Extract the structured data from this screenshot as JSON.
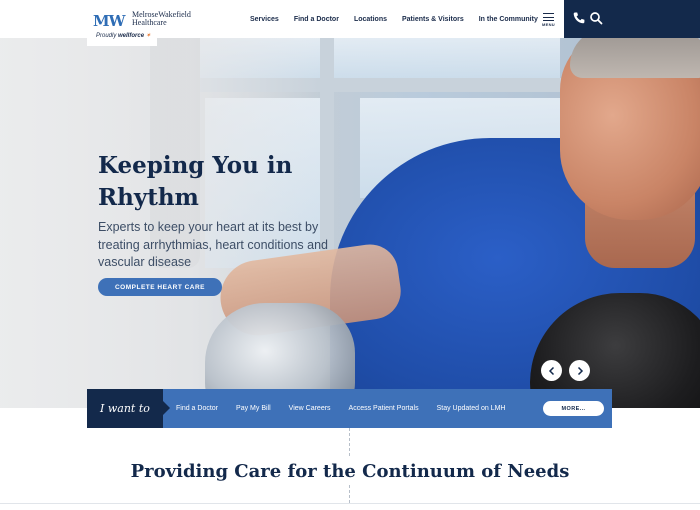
{
  "header": {
    "logo_mark": "MW",
    "logo_name_line1": "MelroseWakefield",
    "logo_name_line2": "Healthcare",
    "logo_tag_prefix": "Proudly",
    "logo_tag_brand": "wellforce",
    "nav": [
      "Services",
      "Find a Doctor",
      "Locations",
      "Patients & Visitors",
      "In the Community"
    ],
    "menu_label": "MENU",
    "icons": [
      "phone-icon",
      "search-icon",
      "hamburger-icon"
    ],
    "colors": {
      "navy": "#13294b",
      "accent": "#3e71b8"
    }
  },
  "hero": {
    "title": "Keeping You in Rhythm",
    "subtitle": "Experts to keep your heart at its best by treating arrhythmias, heart conditions and vascular disease",
    "cta": "COMPLETE HEART CARE",
    "carousel": {
      "prev": "‹",
      "next": "›"
    }
  },
  "i_want_to": {
    "label": "I want to",
    "links": [
      "Find a Doctor",
      "Pay My Bill",
      "View Careers",
      "Access Patient Portals",
      "Stay Updated on LMH"
    ],
    "more": "MORE..."
  },
  "section": {
    "heading": "Providing Care for the Continuum of Needs"
  }
}
